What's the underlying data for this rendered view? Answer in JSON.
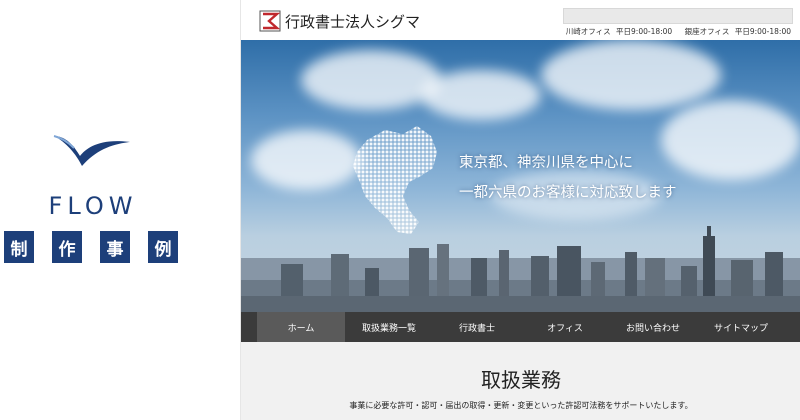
{
  "showcase": {
    "brand": "FLOW",
    "badges": [
      "制",
      "作",
      "事",
      "例"
    ],
    "brand_color": "#1d3f7a"
  },
  "site": {
    "brand_name": "行政書士法人シグマ",
    "offices": [
      {
        "name": "川崎オフィス",
        "hours": "平日9:00-18:00"
      },
      {
        "name": "銀座オフィス",
        "hours": "平日9:00-18:00"
      }
    ],
    "hero": {
      "line1": "東京都、神奈川県を中心に",
      "line2": "一都六県のお客様に対応致します"
    },
    "nav": [
      {
        "label": "ホーム",
        "active": true
      },
      {
        "label": "取扱業務一覧",
        "active": false
      },
      {
        "label": "行政書士",
        "active": false
      },
      {
        "label": "オフィス",
        "active": false
      },
      {
        "label": "お問い合わせ",
        "active": false
      },
      {
        "label": "サイトマップ",
        "active": false
      }
    ],
    "section": {
      "title": "取扱業務",
      "description": "事業に必要な許可・認可・届出の取得・更新・変更といった許認可法務をサポートいたします。"
    },
    "colors": {
      "nav_bg": "#3b3b3b",
      "nav_active": "#5a5a5a",
      "section_bg": "#f1f1f1"
    }
  }
}
